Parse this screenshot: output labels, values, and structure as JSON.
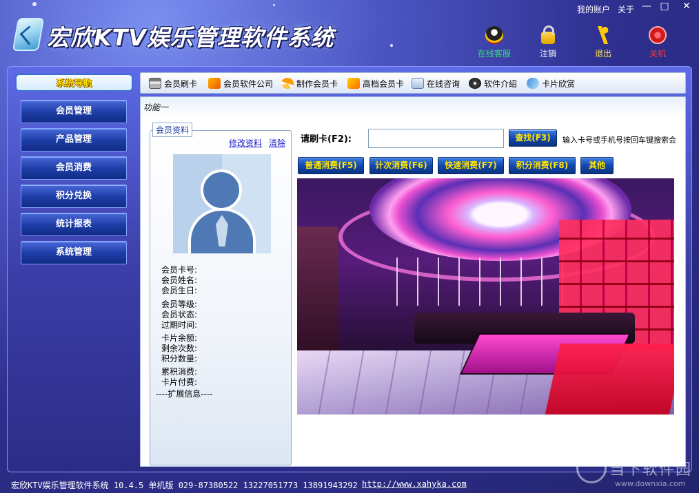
{
  "header": {
    "title": "宏欣KTV娱乐管理软件系统",
    "my_account": "我的账户",
    "about": "关于",
    "window_controls": {
      "minimize": "—",
      "maximize": "□",
      "close": "✕"
    },
    "buttons": {
      "online_service": "在线客服",
      "logout": "注销",
      "exit": "退出",
      "shutdown": "关机"
    },
    "button_colors": {
      "online_service": "#36e07a",
      "logout": "#ffffff",
      "exit": "#ffe24a",
      "shutdown": "#ff3b3b"
    }
  },
  "sidebar": {
    "title": "系统导航",
    "items": [
      {
        "label": "会员管理"
      },
      {
        "label": "产品管理"
      },
      {
        "label": "会员消费"
      },
      {
        "label": "积分兑换"
      },
      {
        "label": "统计报表"
      },
      {
        "label": "系统管理"
      }
    ]
  },
  "toolbar": {
    "items": [
      {
        "label": "会员刷卡",
        "icon": "swipe-card-icon"
      },
      {
        "label": "会员软件公司",
        "icon": "company-icon"
      },
      {
        "label": "制作会员卡",
        "icon": "make-card-icon"
      },
      {
        "label": "高档会员卡",
        "icon": "premium-card-icon"
      },
      {
        "label": "在线咨询",
        "icon": "mail-icon"
      },
      {
        "label": "软件介绍",
        "icon": "disc-icon"
      },
      {
        "label": "卡片欣赏",
        "icon": "gallery-icon"
      }
    ]
  },
  "main": {
    "tab_label": "功能一",
    "member_info": {
      "legend": "会员资料",
      "edit_link": "修改资料",
      "clear_link": "清除",
      "fields": {
        "card_no": "会员卡号:",
        "name": "会员姓名:",
        "birthday": "会员生日:",
        "level": "会员等级:",
        "status": "会员状态:",
        "expire": "过期时间:",
        "balance": "卡片余额:",
        "remaining": "剩余次数:",
        "points": "积分数量:",
        "total_consume": "累积消费:",
        "card_fee": "卡片付费:",
        "extended": "----扩展信息----"
      }
    },
    "swipe": {
      "label": "请刷卡(F2):",
      "value": "",
      "search_button": "查找(F3)",
      "hint": "输入卡号或手机号按回车键搜索会"
    },
    "consume_buttons": {
      "normal": "普通消费(F5)",
      "count": "计次消费(F6)",
      "quick": "快速消费(F7)",
      "points": "积分消费(F8)",
      "other": "其他"
    }
  },
  "status_bar": {
    "text": "宏欣KTV娱乐管理软件系统 10.4.5 单机版 029-87380522 13227051773 13891943292",
    "website": "http://www.xahyka.com"
  },
  "watermark": {
    "main": "当下软件园",
    "url": "www.downxia.com"
  },
  "colors": {
    "accent_gold": "#ffe600",
    "nav_blue": "#1e3fa8",
    "background": "#2e2f8e"
  }
}
